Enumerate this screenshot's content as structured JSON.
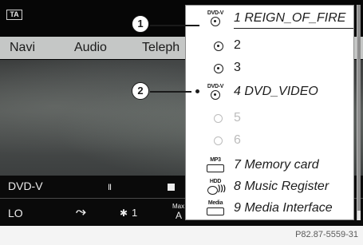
{
  "status": {
    "ta_badge": "TA"
  },
  "main_menu": {
    "items": [
      "Navi",
      "Audio",
      "Teleph"
    ]
  },
  "bottom_bar": {
    "source": "DVD-V",
    "pause_glyph": "II",
    "fan_left": "LO",
    "fan_speed": "1",
    "max_label": "Max",
    "max_value": "A"
  },
  "disc_menu": {
    "items": [
      {
        "number": "1",
        "title": "REIGN_OF_FIRE",
        "icon": "dvd-video-icon",
        "icon_tag": "DVD-V",
        "selected": true,
        "enabled": true
      },
      {
        "number": "2",
        "title": "",
        "icon": "disc-icon",
        "enabled": true
      },
      {
        "number": "3",
        "title": "",
        "icon": "disc-icon",
        "enabled": true
      },
      {
        "number": "4",
        "title": "DVD_VIDEO",
        "icon": "dvd-video-icon",
        "icon_tag": "DVD-V",
        "active": true,
        "enabled": true
      },
      {
        "number": "5",
        "title": "",
        "icon": "empty-slot-icon",
        "enabled": false
      },
      {
        "number": "6",
        "title": "",
        "icon": "empty-slot-icon",
        "enabled": false
      },
      {
        "number": "7",
        "title": "Memory card",
        "icon": "mp3-card-icon",
        "icon_tag": "MP3",
        "enabled": true
      },
      {
        "number": "8",
        "title": "Music Register",
        "icon": "hdd-icon",
        "icon_tag": "HDD",
        "enabled": true
      },
      {
        "number": "9",
        "title": "Media Interface",
        "icon": "media-interface-icon",
        "icon_tag": "Media",
        "enabled": true
      }
    ],
    "labels": {
      "item1": "1 REIGN_OF_FIRE",
      "item2": "2",
      "item3": "3",
      "item4": "4 DVD_VIDEO",
      "item5": "5",
      "item6": "6",
      "item7": "7 Memory card",
      "item8": "8 Music Register",
      "item9": "9 Media Interface"
    },
    "icon_tags": {
      "dvd": "DVD-V",
      "mp3": "MP3",
      "hdd": "HDD",
      "media": "Media"
    }
  },
  "callouts": [
    "1",
    "2"
  ],
  "figure_code": "P82.87-5559-31",
  "colors": {
    "menu_bar": "#c5c7c6",
    "panel": "#ffffff",
    "dim_text": "#bcbcbc",
    "screen_bg": "#050505"
  }
}
